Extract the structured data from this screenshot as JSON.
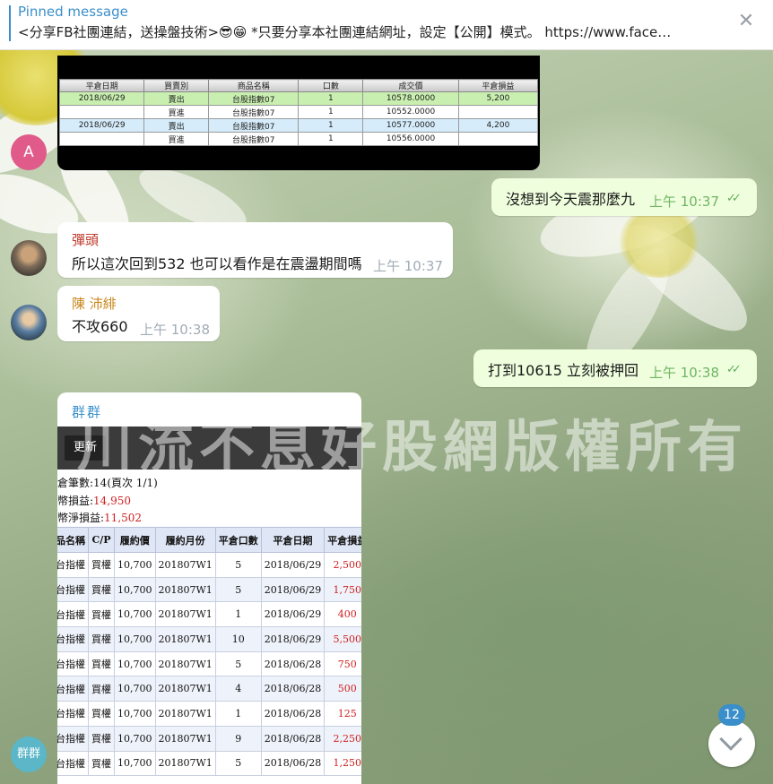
{
  "pinned": {
    "title": "Pinned message",
    "text": "<分享FB社團連結，送操盤技術>😎😁 *只要分享本社團連結網址，設定【公開】模式。 https://www.face…"
  },
  "avatars": {
    "a_initial": "A",
    "group_label": "群群"
  },
  "trade_image": {
    "headers": [
      "平倉日期",
      "買賣別",
      "商品名稱",
      "口數",
      "成交價",
      "平倉損益"
    ],
    "rows": [
      [
        "2018/06/29",
        "賣出",
        "台股指數07",
        "1",
        "10578.0000",
        "5,200"
      ],
      [
        "",
        "買進",
        "台股指數07",
        "1",
        "10552.0000",
        ""
      ],
      [
        "2018/06/29",
        "賣出",
        "台股指數07",
        "1",
        "10577.0000",
        "4,200"
      ],
      [
        "",
        "買進",
        "台股指數07",
        "1",
        "10556.0000",
        ""
      ]
    ]
  },
  "messages": {
    "m1": {
      "text": "沒想到今天震那麼九",
      "time": "上午 10:37"
    },
    "m2": {
      "name": "彈頭",
      "text": "所以這次回到532 也可以看作是在震盪期間嗎",
      "time": "上午 10:37"
    },
    "m3": {
      "name": "陳 沛緋",
      "text": "不攻660",
      "time": "上午 10:38"
    },
    "m4": {
      "text": "打到10615  立刻被押回",
      "time": "上午 10:38"
    }
  },
  "colors": {
    "name_m2": "#c0392b",
    "name_m3": "#c8861a"
  },
  "options_image": {
    "sender": "群群",
    "refresh_label": "更新",
    "summary_line1": "倉筆數:14(頁次 1/1)",
    "summary_line2_label": "幣損益:",
    "summary_line2_value": "14,950",
    "summary_line3_label": "幣淨損益:",
    "summary_line3_value": "11,502",
    "headers": [
      "品名稱",
      "C/P",
      "履約價",
      "履約月份",
      "平倉口數",
      "平倉日期",
      "平倉損益"
    ],
    "rows": [
      [
        "台指權",
        "買權",
        "10,700",
        "201807W1",
        "5",
        "2018/06/29",
        "2,500"
      ],
      [
        "台指權",
        "買權",
        "10,700",
        "201807W1",
        "5",
        "2018/06/29",
        "1,750"
      ],
      [
        "台指權",
        "買權",
        "10,700",
        "201807W1",
        "1",
        "2018/06/29",
        "400"
      ],
      [
        "台指權",
        "買權",
        "10,700",
        "201807W1",
        "10",
        "2018/06/29",
        "5,500"
      ],
      [
        "台指權",
        "買權",
        "10,700",
        "201807W1",
        "5",
        "2018/06/28",
        "750"
      ],
      [
        "台指權",
        "買權",
        "10,700",
        "201807W1",
        "4",
        "2018/06/28",
        "500"
      ],
      [
        "台指權",
        "買權",
        "10,700",
        "201807W1",
        "1",
        "2018/06/28",
        "125"
      ],
      [
        "台指權",
        "買權",
        "10,700",
        "201807W1",
        "9",
        "2018/06/28",
        "2,250"
      ],
      [
        "台指權",
        "買權",
        "10,700",
        "201807W1",
        "5",
        "2018/06/28",
        "1,250"
      ]
    ]
  },
  "watermark": "川流不息好股網版權所有",
  "unread_count": "12"
}
